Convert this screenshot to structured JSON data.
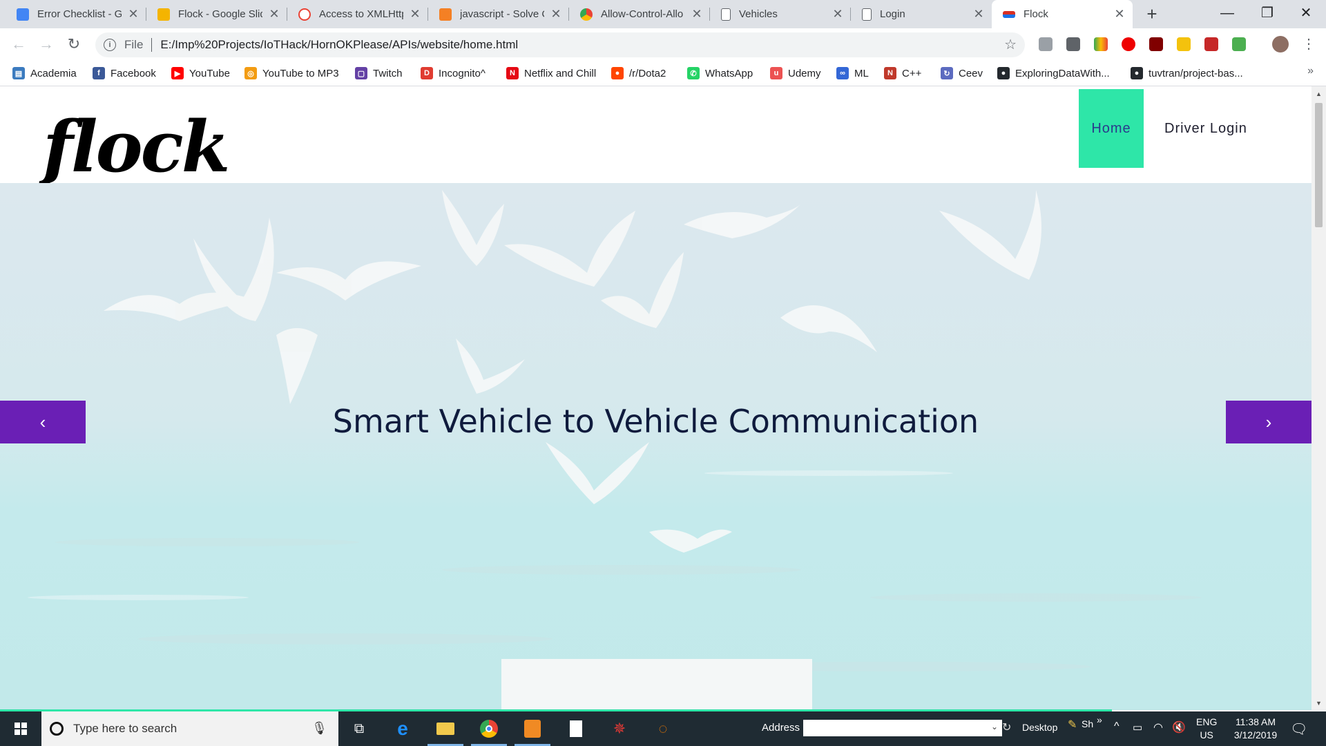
{
  "browser": {
    "tabs": [
      {
        "title": "Error Checklist - Go",
        "favicon": "docs-icon",
        "color": "#4285f4",
        "active": false
      },
      {
        "title": "Flock - Google Slid",
        "favicon": "slides-icon",
        "color": "#f4b400",
        "active": false
      },
      {
        "title": "Access to XMLHttp",
        "favicon": "google-icon",
        "color": "#ea4335",
        "active": false
      },
      {
        "title": "javascript - Solve C",
        "favicon": "stackoverflow-icon",
        "color": "#f48024",
        "active": false
      },
      {
        "title": "Allow-Control-Allo",
        "favicon": "chrome-store-icon",
        "color": "#34a853",
        "active": false
      },
      {
        "title": "Vehicles",
        "favicon": "page-icon",
        "color": "#5f6368",
        "active": false
      },
      {
        "title": "Login",
        "favicon": "page-icon",
        "color": "#5f6368",
        "active": false
      },
      {
        "title": "Flock",
        "favicon": "flock-site-icon",
        "color": "#d93025",
        "active": true
      }
    ],
    "new_tab": "+",
    "window_controls": {
      "minimize": "—",
      "maximize": "❐",
      "close": "✕"
    },
    "url_scheme_label": "File",
    "url": "E:/Imp%20Projects/IoTHack/HornOKPlease/APIs/website/home.html",
    "bookmarks": [
      {
        "label": "Academia",
        "icon": "academia-icon",
        "color": "#3b7bbf",
        "glyph": "▤"
      },
      {
        "label": "Facebook",
        "icon": "facebook-icon",
        "color": "#3b5998",
        "glyph": "f"
      },
      {
        "label": "YouTube",
        "icon": "youtube-icon",
        "color": "#ff0000",
        "glyph": "▶"
      },
      {
        "label": "YouTube to MP3",
        "icon": "mp3-icon",
        "color": "#f39c12",
        "glyph": "◎"
      },
      {
        "label": "Twitch",
        "icon": "twitch-icon",
        "color": "#6441a5",
        "glyph": "▢"
      },
      {
        "label": "Incognito^",
        "icon": "incognito-icon",
        "color": "#e03c31",
        "glyph": "D"
      },
      {
        "label": "Netflix and Chill",
        "icon": "netflix-icon",
        "color": "#e50914",
        "glyph": "N"
      },
      {
        "label": "/r/Dota2",
        "icon": "reddit-icon",
        "color": "#ff4500",
        "glyph": "●"
      },
      {
        "label": "WhatsApp",
        "icon": "whatsapp-icon",
        "color": "#25d366",
        "glyph": "✆"
      },
      {
        "label": "Udemy",
        "icon": "udemy-icon",
        "color": "#ec5252",
        "glyph": "u"
      },
      {
        "label": "ML",
        "icon": "ml-icon",
        "color": "#3367d6",
        "glyph": "∞"
      },
      {
        "label": "C++",
        "icon": "cpp-icon",
        "color": "#c0392b",
        "glyph": "N"
      },
      {
        "label": "Ceev",
        "icon": "ceev-icon",
        "color": "#5c6bc0",
        "glyph": "↻"
      },
      {
        "label": "ExploringDataWith...",
        "icon": "github-icon",
        "color": "#24292e",
        "glyph": "●"
      },
      {
        "label": "tuvtran/project-bas...",
        "icon": "github-icon",
        "color": "#24292e",
        "glyph": "●"
      }
    ],
    "bookmarks_more": "»"
  },
  "site": {
    "logo": "flock",
    "nav": {
      "home": "Home",
      "driver_login": "Driver Login"
    },
    "hero_title": "Smart Vehicle to Vehicle Communication",
    "prev_arrow": "‹",
    "next_arrow": "›",
    "accent_color": "#2ee6a8",
    "arrow_color": "#6a1fb5"
  },
  "taskbar": {
    "search_placeholder": "Type here to search",
    "address_label": "Address",
    "desktop_label": "Desktop",
    "lang_short": "Sh",
    "chevron": "»",
    "lang": "ENG",
    "region": "US",
    "time": "11:38 AM",
    "date": "3/12/2019"
  }
}
